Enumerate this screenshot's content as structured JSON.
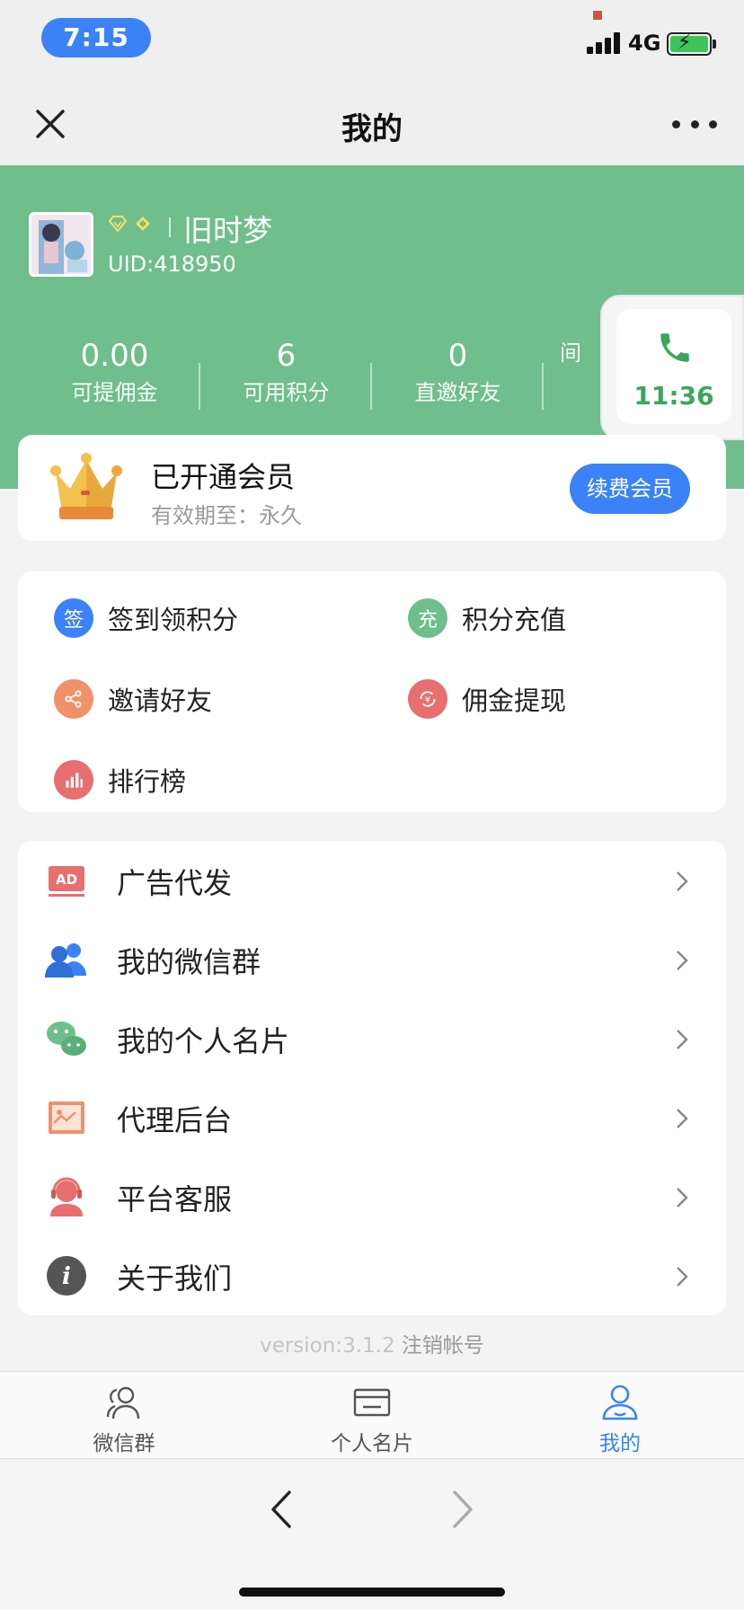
{
  "status_bar": {
    "time": "7:15",
    "network": "4G"
  },
  "nav": {
    "title": "我的"
  },
  "profile": {
    "name": "旧时梦",
    "uid": "UID:418950"
  },
  "stats": [
    {
      "value": "0.00",
      "label": "可提佣金"
    },
    {
      "value": "6",
      "label": "可用积分"
    },
    {
      "value": "0",
      "label": "直邀好友"
    },
    {
      "value": "",
      "label": "间"
    }
  ],
  "call_widget": {
    "time": "11:36"
  },
  "member": {
    "title": "已开通会员",
    "validity": "有效期至：永久",
    "renew_label": "续费会员"
  },
  "quick_actions": [
    {
      "icon": "签",
      "label": "签到领积分",
      "color": "#3b82f6"
    },
    {
      "icon": "充",
      "label": "积分充值",
      "color": "#6fbe8c"
    },
    {
      "icon": "share-icon",
      "label": "邀请好友",
      "color": "#f0916a"
    },
    {
      "icon": "withdraw-icon",
      "label": "佣金提现",
      "color": "#e76f6f"
    },
    {
      "icon": "ranking-icon",
      "label": "排行榜",
      "color": "#e76f6f"
    }
  ],
  "menu": [
    {
      "icon": "ad-icon",
      "label": "广告代发"
    },
    {
      "icon": "group-icon",
      "label": "我的微信群"
    },
    {
      "icon": "wechat-icon",
      "label": "我的个人名片"
    },
    {
      "icon": "agent-icon",
      "label": "代理后台"
    },
    {
      "icon": "support-icon",
      "label": "平台客服"
    },
    {
      "icon": "info-icon",
      "label": "关于我们"
    }
  ],
  "footer": {
    "version": "version:3.1.2",
    "cancel_account": "注销帐号"
  },
  "tabs": [
    {
      "label": "微信群",
      "active": false
    },
    {
      "label": "个人名片",
      "active": false
    },
    {
      "label": "我的",
      "active": true
    }
  ],
  "colors": {
    "accent": "#3b82f6",
    "header": "#6fbe8c",
    "call_green": "#3aa75c"
  }
}
